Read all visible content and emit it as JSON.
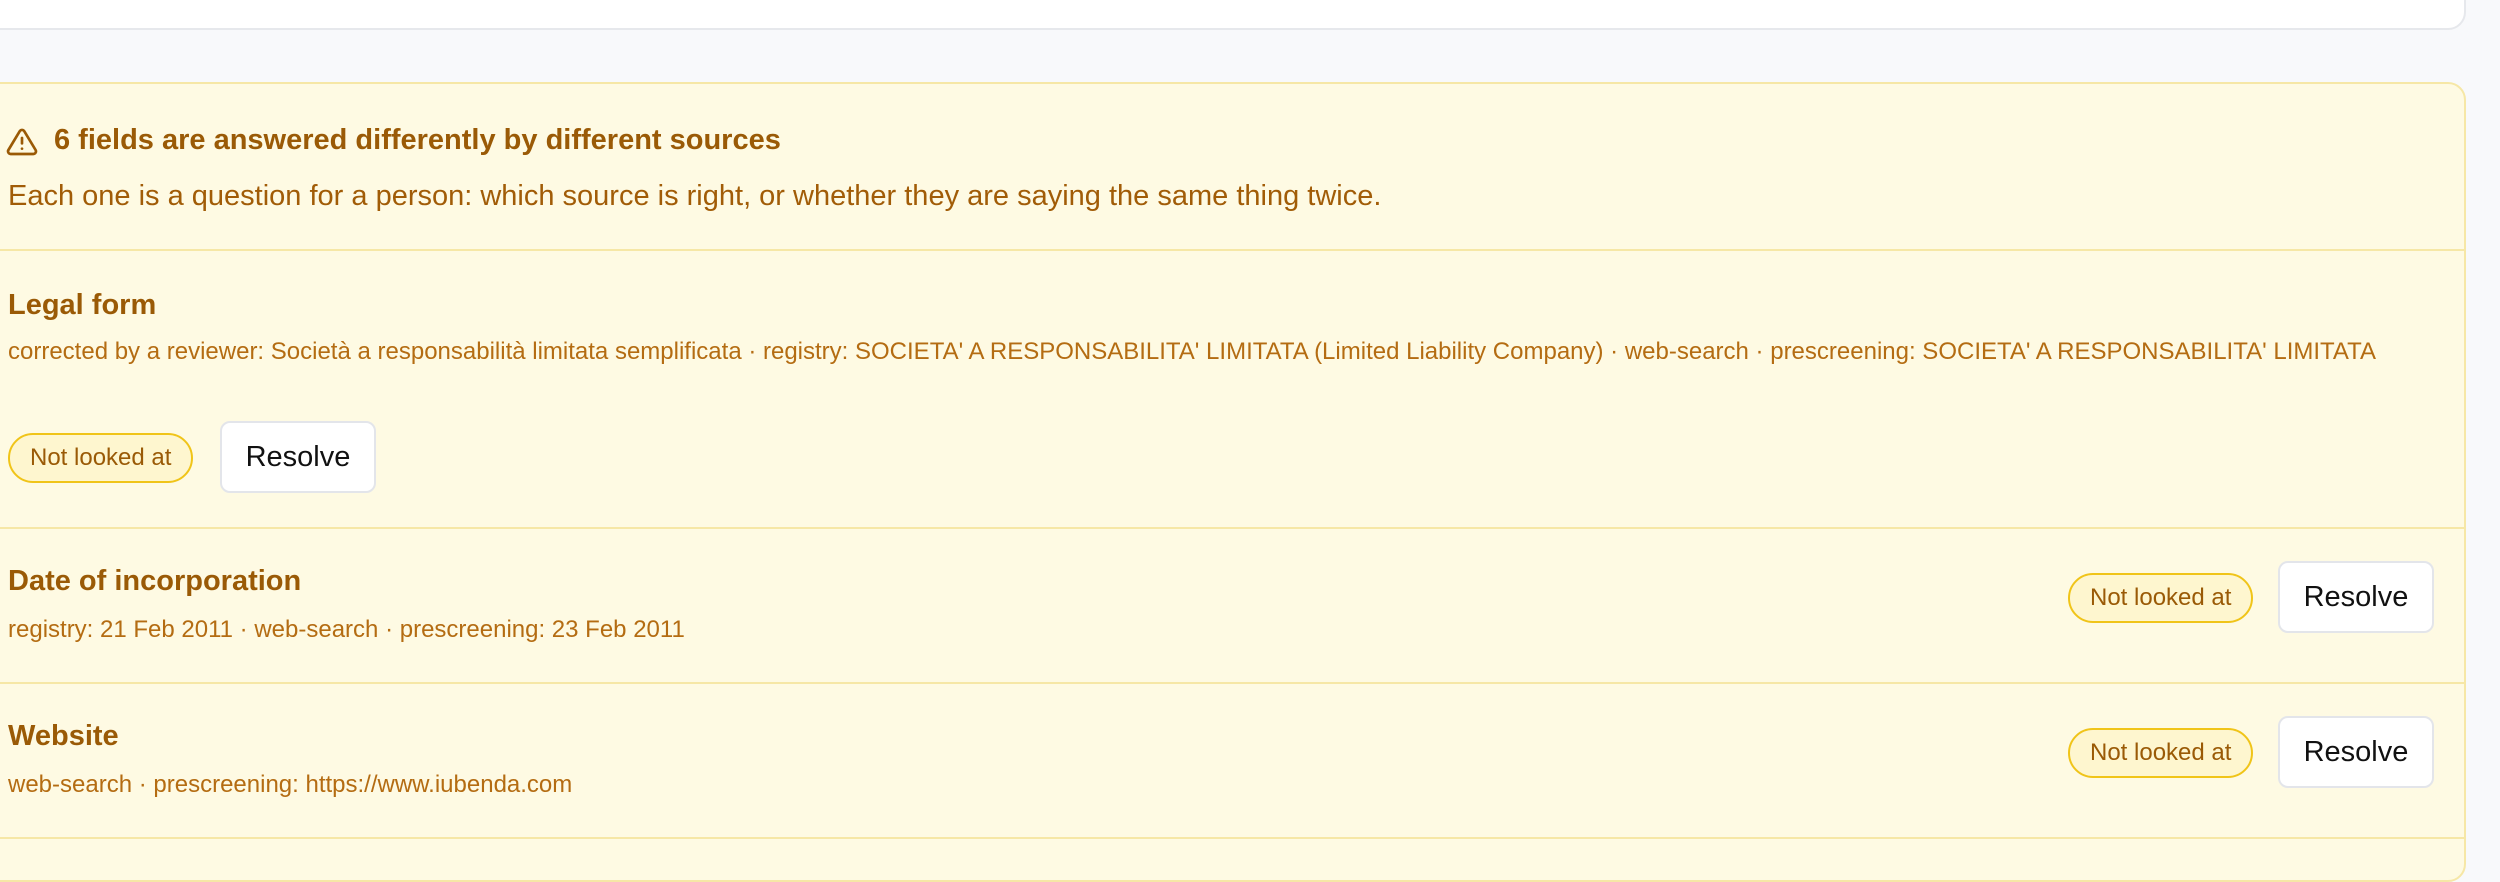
{
  "conflicts_panel": {
    "title": "6 fields are answered differently by different sources",
    "subtitle": "Each one is a question for a person: which source is right, or whether they are saying the same thing twice.",
    "icon": "warning-triangle-icon",
    "colors": {
      "panel_background": "#fefae3",
      "panel_border": "#f6e7a6",
      "text": "#a15c07",
      "badge_border": "#f0c419"
    },
    "fields": [
      {
        "name": "Legal form",
        "sources": "corrected by a reviewer: Società a responsabilità limitata semplificata · registry: SOCIETA' A RESPONSABILITA' LIMITATA (Limited Liability Company) · web-search · prescreening: SOCIETA' A RESPONSABILITA' LIMITATA",
        "status": "Not looked at",
        "action": "Resolve"
      },
      {
        "name": "Date of incorporation",
        "sources": "registry: 21 Feb 2011 · web-search · prescreening: 23 Feb 2011",
        "status": "Not looked at",
        "action": "Resolve"
      },
      {
        "name": "Website",
        "sources": "web-search · prescreening: https://www.iubenda.com",
        "status": "Not looked at",
        "action": "Resolve"
      }
    ]
  }
}
